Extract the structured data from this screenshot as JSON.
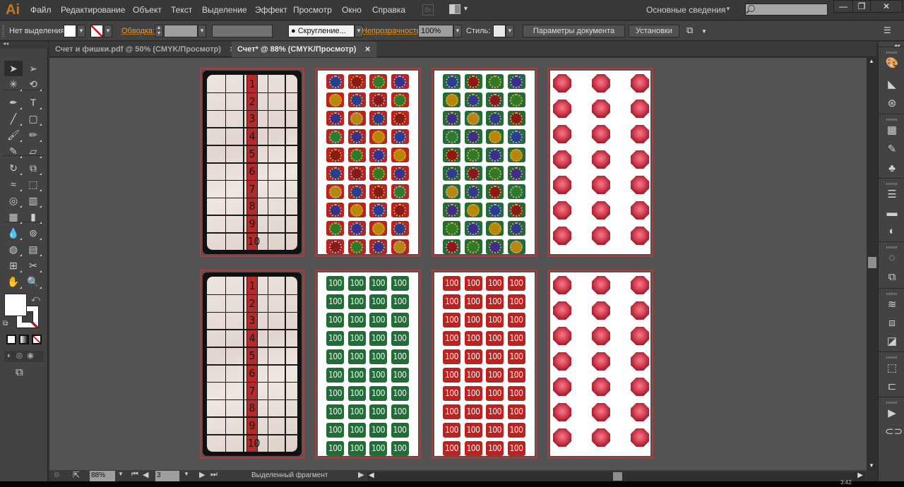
{
  "app": {
    "logo": "Ai",
    "name": "Adobe Illustrator"
  },
  "menu": [
    "Файл",
    "Редактирование",
    "Объект",
    "Текст",
    "Выделение",
    "Эффект",
    "Просмотр",
    "Окно",
    "Справка"
  ],
  "menubar": {
    "bridge_label": "Br",
    "workspace": "Основные сведения",
    "search_placeholder": "",
    "window_buttons": {
      "minimize": "—",
      "restore": "❐",
      "close": "✕"
    }
  },
  "controlbar": {
    "selection_label": "Нет выделения",
    "stroke_label": "Обводка:",
    "stroke_weight": "",
    "brush_profile": "",
    "brush": "Скругление...",
    "opacity_label": "Непрозрачность:",
    "opacity_value": "100%",
    "styles_label": "Стиль:",
    "doc_setup_button": "Параметры документа",
    "preferences_button": "Установки"
  },
  "tabs": [
    {
      "label": "Счет и фишки.pdf @ 50% (CMYK/Просмотр)",
      "active": false
    },
    {
      "label": "Счет* @ 88% (CMYK/Просмотр)",
      "active": true
    }
  ],
  "tools": [
    "selection-tool",
    "direct-selection-tool",
    "magic-wand-tool",
    "lasso-tool",
    "pen-tool",
    "type-tool",
    "line-segment-tool",
    "rectangle-tool",
    "paintbrush-tool",
    "pencil-tool",
    "blob-brush-tool",
    "eraser-tool",
    "rotate-tool",
    "scale-tool",
    "warp-tool",
    "free-transform-tool",
    "shape-builder-tool",
    "graph-tool",
    "mesh-tool",
    "gradient-tool",
    "eyedropper-tool",
    "blend-tool",
    "symbol-sprayer-tool",
    "column-graph-tool",
    "artboard-tool",
    "slice-tool",
    "hand-tool",
    "zoom-tool"
  ],
  "tool_glyphs": [
    "➤",
    "➢",
    "✳",
    "⟲",
    "✒",
    "T",
    "╱",
    "▢",
    "🖌",
    "✏",
    "✎",
    "▱",
    "↻",
    "⧉",
    "≈",
    "⬚",
    "◎",
    "▥",
    "▦",
    "▮",
    "💧",
    "⊚",
    "◍",
    "▤",
    "⊞",
    "✂",
    "✋",
    "🔍"
  ],
  "colors": {
    "fill": "#ffffff",
    "stroke": "none",
    "accent": "#e59834",
    "artboard_border": "#b23a3a",
    "chip_red": "#c0201e",
    "chip_green": "#1e6e36"
  },
  "score_sheet": {
    "numbers": [
      "1",
      "2",
      "3",
      "4",
      "5",
      "6",
      "7",
      "8",
      "9",
      "10"
    ]
  },
  "token_sheets": {
    "red_badges_rows": 10,
    "red_badges_cols": 4,
    "green_badges_rows": 10,
    "green_badges_cols": 4,
    "gems_rows": 7,
    "gems_cols": 3
  },
  "money_chips": {
    "label": "100",
    "rows": 10,
    "cols": 4
  },
  "right_panels": [
    "color-guide-icon",
    "color-icon",
    "swatches-share-icon",
    "swatches-icon",
    "brushes-icon",
    "symbols-icon",
    "stroke-icon",
    "gradient-icon",
    "transparency-icon",
    "appearance-icon",
    "graphic-styles-icon",
    "layers-icon",
    "artboards-icon",
    "pathfinder-icon",
    "transform-icon",
    "align-icon",
    "actions-icon",
    "links-icon"
  ],
  "right_glyphs": [
    "🎨",
    "◣",
    "⊛",
    "▦",
    "✎",
    "♣",
    "☰",
    "▬",
    "◐",
    "◌",
    "⧉",
    "≋",
    "⧈",
    "◪",
    "⬚",
    "⊏",
    "▶",
    "⊂⊃"
  ],
  "statusbar": {
    "zoom": "88%",
    "artboard_number": "3",
    "status_text": "Выделенный фрагмент"
  },
  "clock": "3:42"
}
